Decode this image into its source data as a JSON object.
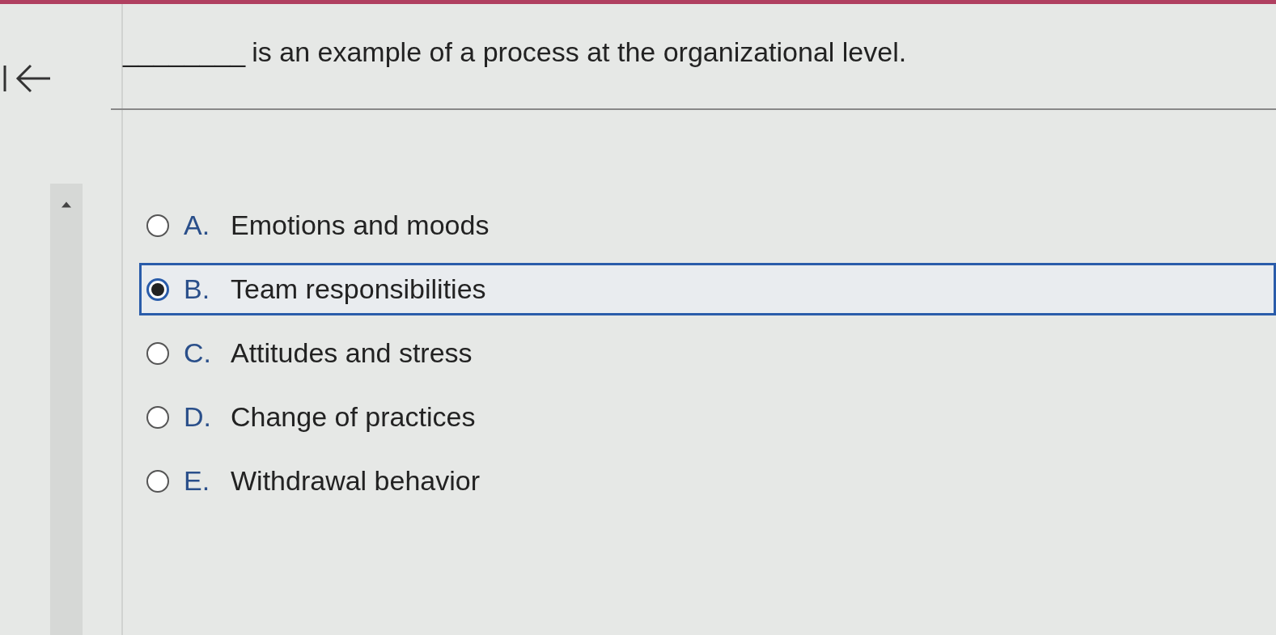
{
  "question": {
    "blank": "________",
    "text": "is an example of a process at the organizational level."
  },
  "options": [
    {
      "letter": "A.",
      "label": "Emotions and moods",
      "selected": false
    },
    {
      "letter": "B.",
      "label": "Team responsibilities",
      "selected": true
    },
    {
      "letter": "C.",
      "label": "Attitudes and stress",
      "selected": false
    },
    {
      "letter": "D.",
      "label": "Change of practices",
      "selected": false
    },
    {
      "letter": "E.",
      "label": "Withdrawal behavior",
      "selected": false
    }
  ]
}
